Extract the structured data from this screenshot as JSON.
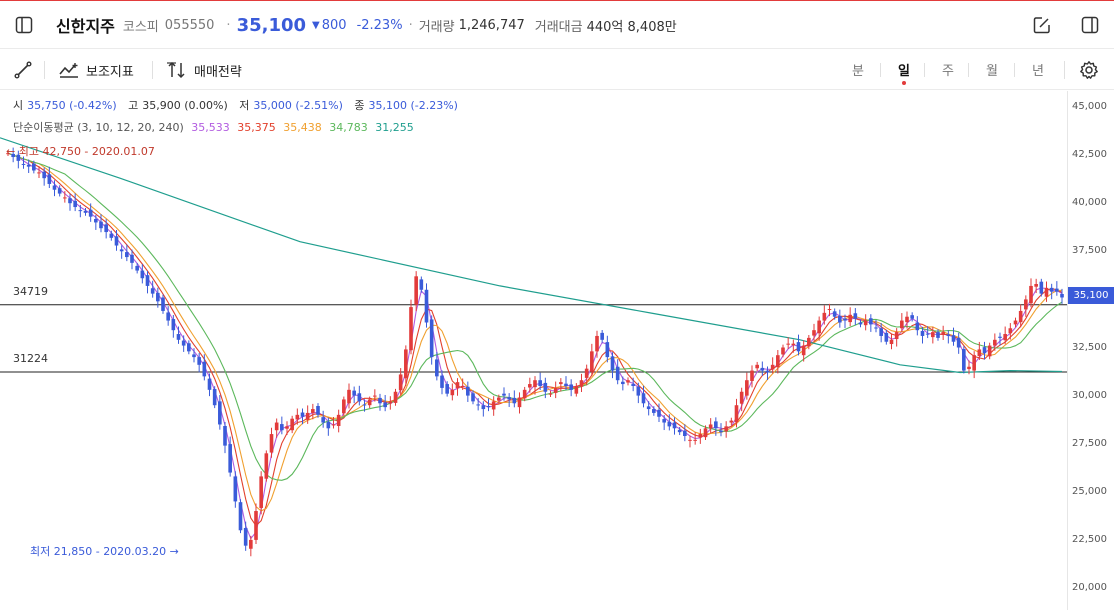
{
  "header": {
    "name": "신한지주",
    "market": "코스피",
    "code": "055550",
    "price": "35,100",
    "change_arrow": "▼",
    "change": "800",
    "change_pct": "-2.23%",
    "volume_label": "거래량",
    "volume": "1,246,747",
    "amount_label": "거래대금",
    "amount": "440억 8,408만"
  },
  "toolbar": {
    "indicator_label": "보조지표",
    "strategy_label": "매매전략",
    "periods": [
      "분",
      "일",
      "주",
      "월",
      "년"
    ],
    "active_period": "일"
  },
  "ohlc": {
    "open_label": "시",
    "open": "35,750 (-0.42%)",
    "high_label": "고",
    "high": "35,900 (0.00%)",
    "low_label": "저",
    "low": "35,000 (-2.51%)",
    "close_label": "종",
    "close": "35,100 (-2.23%)"
  },
  "ma": {
    "label": "단순이동평균 (3, 10, 12, 20, 240)",
    "values": [
      "35,533",
      "35,375",
      "35,438",
      "34,783",
      "31,255"
    ],
    "colors": [
      "#b25ce0",
      "#e2402c",
      "#f0a030",
      "#5cb85c",
      "#1f9e8e"
    ]
  },
  "annotations": {
    "high": "← 최고 42,750 - 2020.01.07",
    "low": "최저 21,850 - 2020.03.20 →"
  },
  "hlines": [
    "34719",
    "31224"
  ],
  "chart_data": {
    "type": "candlestick",
    "y_ticks": [
      "45,000",
      "42,500",
      "40,000",
      "37,500",
      "35,000",
      "32,500",
      "30,000",
      "27,500",
      "25,000",
      "22,500",
      "20,000"
    ],
    "ylim": [
      20000,
      45000
    ],
    "last_price": "35,100",
    "close_series": [
      42600,
      42400,
      42200,
      42000,
      41900,
      41700,
      41600,
      41300,
      41000,
      40700,
      40500,
      40300,
      40000,
      39800,
      39600,
      39500,
      39300,
      39000,
      38700,
      38500,
      38200,
      37800,
      37500,
      37200,
      36900,
      36500,
      36100,
      35700,
      35300,
      34900,
      34400,
      33900,
      33400,
      32900,
      32600,
      32300,
      32000,
      31600,
      31000,
      30300,
      29500,
      28500,
      27400,
      26000,
      24500,
      23000,
      22200,
      22500,
      24000,
      25800,
      27000,
      28000,
      28600,
      28200,
      28400,
      28800,
      29000,
      28900,
      29100,
      29300,
      29000,
      28600,
      28300,
      28500,
      29000,
      29800,
      30300,
      30000,
      29700,
      29500,
      29800,
      30000,
      29600,
      29400,
      29700,
      30200,
      31100,
      32400,
      34600,
      36200,
      35500,
      33800,
      32000,
      31000,
      30400,
      30100,
      30300,
      30700,
      30500,
      30000,
      29700,
      29500,
      29300,
      29400,
      29700,
      29900,
      30000,
      29800,
      29600,
      29900,
      30300,
      30600,
      30800,
      30500,
      30200,
      30100,
      30400,
      30700,
      30500,
      30300,
      30500,
      30800,
      31400,
      32300,
      33100,
      32900,
      32000,
      31300,
      30800,
      30600,
      30800,
      30500,
      30000,
      29600,
      29300,
      29100,
      28900,
      28600,
      28400,
      28300,
      28100,
      27900,
      27700,
      27700,
      28000,
      28300,
      28500,
      28300,
      28100,
      28400,
      28700,
      29500,
      30200,
      30800,
      31300,
      31600,
      31300,
      31200,
      31600,
      32100,
      32500,
      32700,
      32700,
      32300,
      32600,
      33000,
      33400,
      33900,
      34300,
      34500,
      34100,
      33800,
      33900,
      34200,
      34000,
      33700,
      33900,
      33700,
      33500,
      33100,
      32800,
      32900,
      33300,
      33900,
      34100,
      34000,
      33400,
      33100,
      33200,
      33300,
      33000,
      33300,
      33100,
      32800,
      32500,
      31300,
      31500,
      32100,
      32400,
      32200,
      32600,
      32900,
      33000,
      33200,
      33500,
      33900,
      34400,
      35000,
      35700,
      35800,
      35300,
      35600,
      35400,
      35400,
      35100
    ]
  }
}
